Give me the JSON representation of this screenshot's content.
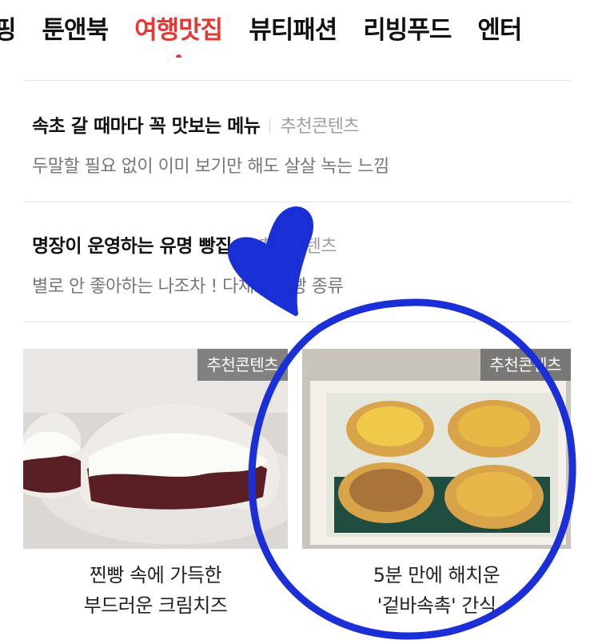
{
  "tabs": [
    {
      "label": "핑"
    },
    {
      "label": "툰앤북"
    },
    {
      "label": "여행맛집",
      "active": true
    },
    {
      "label": "뷰티패션"
    },
    {
      "label": "리빙푸드"
    },
    {
      "label": "엔터"
    }
  ],
  "articles": [
    {
      "title": "속초 갈 때마다 꼭 맛보는 메뉴",
      "tag": "추천콘텐츠",
      "subtitle": "두말할 필요 없이 이미 보기만 해도 살살 녹는 느낌"
    },
    {
      "title": "명장이 운영하는 유명 빵집 ",
      "tag": "추천콘텐츠",
      "subtitle": "별로 안 좋아하는 나조차 ! 다채로운 빵 종류"
    }
  ],
  "cards": [
    {
      "badge": "추천콘텐츠",
      "caption_line1": "찐빵 속에 가득한",
      "caption_line2": "부드러운 크림치즈",
      "image": "cream-cheese-steamed-bun-photo"
    },
    {
      "badge": "추천콘텐츠",
      "caption_line1": "5분 만에 해치운",
      "caption_line2": "'겉바속촉' 간식",
      "image": "egg-tarts-in-box-photo"
    }
  ],
  "colors": {
    "accent": "#e53935",
    "annotation": "#1a2fd6",
    "muted_text": "#777777",
    "tag_text": "#9e9e9e"
  }
}
